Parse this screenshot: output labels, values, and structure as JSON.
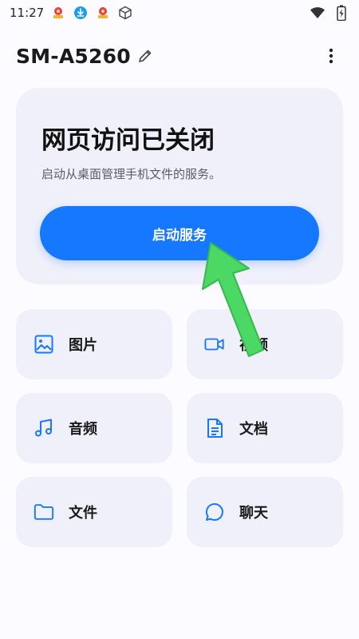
{
  "status_bar": {
    "time": "11:27",
    "icons": [
      "notification-app-icon",
      "download-icon",
      "notification-app-icon",
      "box-icon"
    ],
    "right_icons": [
      "wifi-icon",
      "battery-charging-icon"
    ]
  },
  "header": {
    "device_name": "SM-A5260",
    "edit_icon": "pencil-icon",
    "more_icon": "more-vertical-icon"
  },
  "service_card": {
    "title": "网页访问已关闭",
    "subtitle": "启动从桌面管理手机文件的服务。",
    "button_label": "启动服务"
  },
  "tiles": [
    {
      "label": "图片",
      "icon": "image-icon"
    },
    {
      "label": "视频",
      "icon": "video-icon"
    },
    {
      "label": "音频",
      "icon": "music-icon"
    },
    {
      "label": "文档",
      "icon": "document-icon"
    },
    {
      "label": "文件",
      "icon": "folder-icon"
    },
    {
      "label": "聊天",
      "icon": "chat-icon"
    }
  ],
  "colors": {
    "accent": "#1677ff",
    "card_bg": "#eff0fa",
    "page_bg": "#fcfbff",
    "arrow": "#4cd864"
  }
}
